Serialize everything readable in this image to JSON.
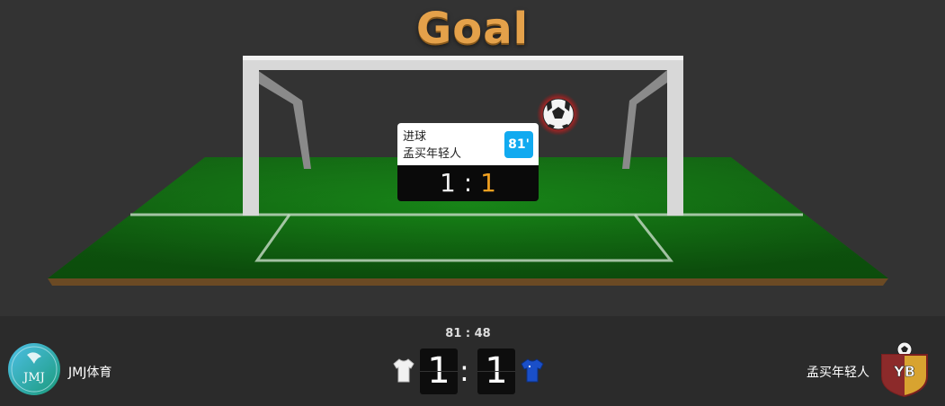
{
  "banner": {
    "title": "Goal"
  },
  "event_popup": {
    "event": "进球",
    "team": "孟买年轻人",
    "minute": "81'",
    "home_score": "1",
    "away_score": "1",
    "separator": ":"
  },
  "scoreboard": {
    "clock": "81 : 48",
    "home_team": "JMJ体育",
    "away_team": "孟买年轻人",
    "home_score": "1",
    "away_score": "1",
    "separator": ":",
    "home_logo_text": "JMJ",
    "away_logo_text": "YB"
  },
  "icons": {
    "ball": "soccer-ball-icon",
    "home_shirt": "white-shirt-icon",
    "away_shirt": "blue-shirt-icon"
  },
  "colors": {
    "accent_title": "#e4a14a",
    "minute_badge": "#11aaf0",
    "away_popup_score": "#f0a020",
    "pitch": "#1a8a1a",
    "background": "#333333"
  }
}
